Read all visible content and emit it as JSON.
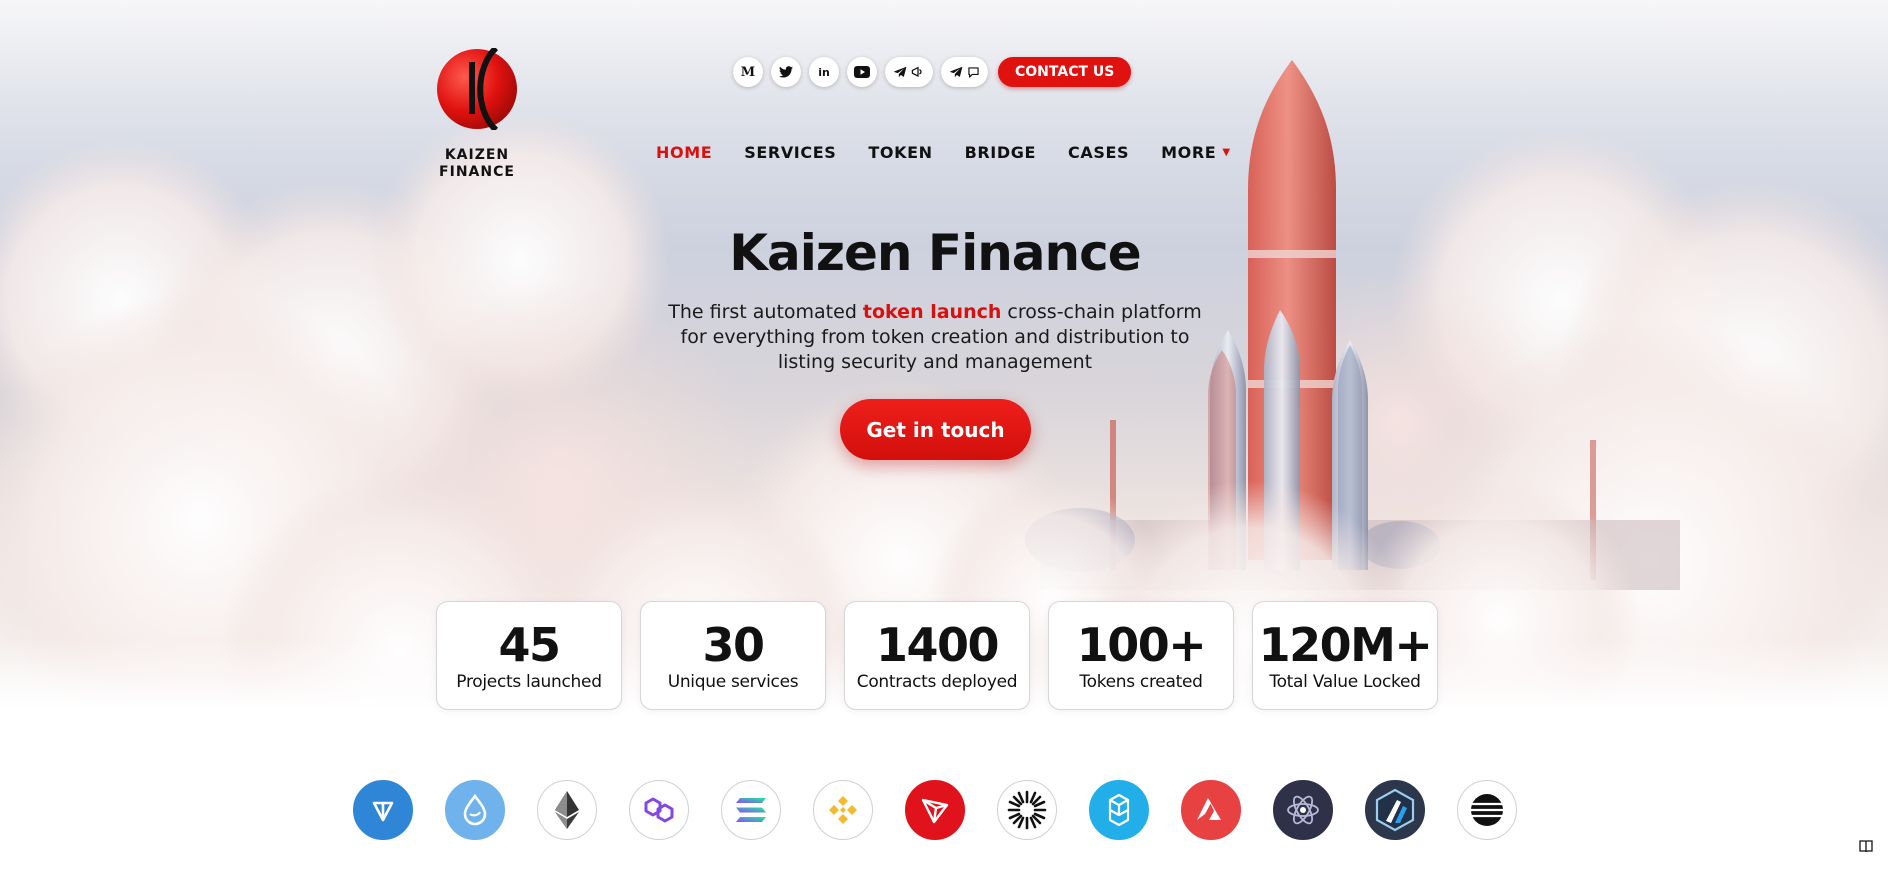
{
  "brand": {
    "name_line1": "KAIZEN",
    "name_line2": "FINANCE",
    "primary_color": "#e0120f"
  },
  "social": {
    "items": [
      {
        "icon": "medium-icon",
        "glyph": "M"
      },
      {
        "icon": "twitter-icon"
      },
      {
        "icon": "linkedin-icon",
        "glyph": "in"
      },
      {
        "icon": "youtube-icon"
      },
      {
        "icon": "telegram-announcements-icon"
      },
      {
        "icon": "telegram-chat-icon"
      }
    ],
    "contact_label": "CONTACT US"
  },
  "nav": {
    "items": [
      {
        "label": "HOME",
        "active": true
      },
      {
        "label": "SERVICES"
      },
      {
        "label": "TOKEN"
      },
      {
        "label": "BRIDGE"
      },
      {
        "label": "CASES"
      },
      {
        "label": "MORE"
      }
    ]
  },
  "hero": {
    "title": "Kaizen Finance",
    "subtitle_pre": "The first automated ",
    "subtitle_highlight": "token launch",
    "subtitle_post": " cross-chain platform for everything from token creation and distribution to listing security and management",
    "cta_label": "Get in touch"
  },
  "stats": [
    {
      "value": "45",
      "label": "Projects launched"
    },
    {
      "value": "30",
      "label": "Unique services"
    },
    {
      "value": "1400",
      "label": "Contracts deployed"
    },
    {
      "value": "100+",
      "label": "Tokens created"
    },
    {
      "value": "120M+",
      "label": "Total Value Locked"
    }
  ],
  "chains": [
    {
      "icon": "ton-icon",
      "color": "#2f86d6"
    },
    {
      "icon": "sui-icon",
      "color": "#6fb2ec"
    },
    {
      "icon": "ethereum-icon",
      "color": "#ffffff"
    },
    {
      "icon": "polygon-icon",
      "color": "#ffffff"
    },
    {
      "icon": "solana-icon",
      "color": "#ffffff"
    },
    {
      "icon": "bnb-icon",
      "color": "#ffffff"
    },
    {
      "icon": "tron-icon",
      "color": "#e0121b"
    },
    {
      "icon": "starburst-chain-icon",
      "color": "#ffffff"
    },
    {
      "icon": "fantom-icon",
      "color": "#22aee8"
    },
    {
      "icon": "avalanche-icon",
      "color": "#e84142"
    },
    {
      "icon": "cosmos-icon",
      "color": "#2e3148"
    },
    {
      "icon": "arbitrum-icon",
      "color": "#2d374b"
    },
    {
      "icon": "aptos-icon",
      "color": "#ffffff"
    }
  ]
}
